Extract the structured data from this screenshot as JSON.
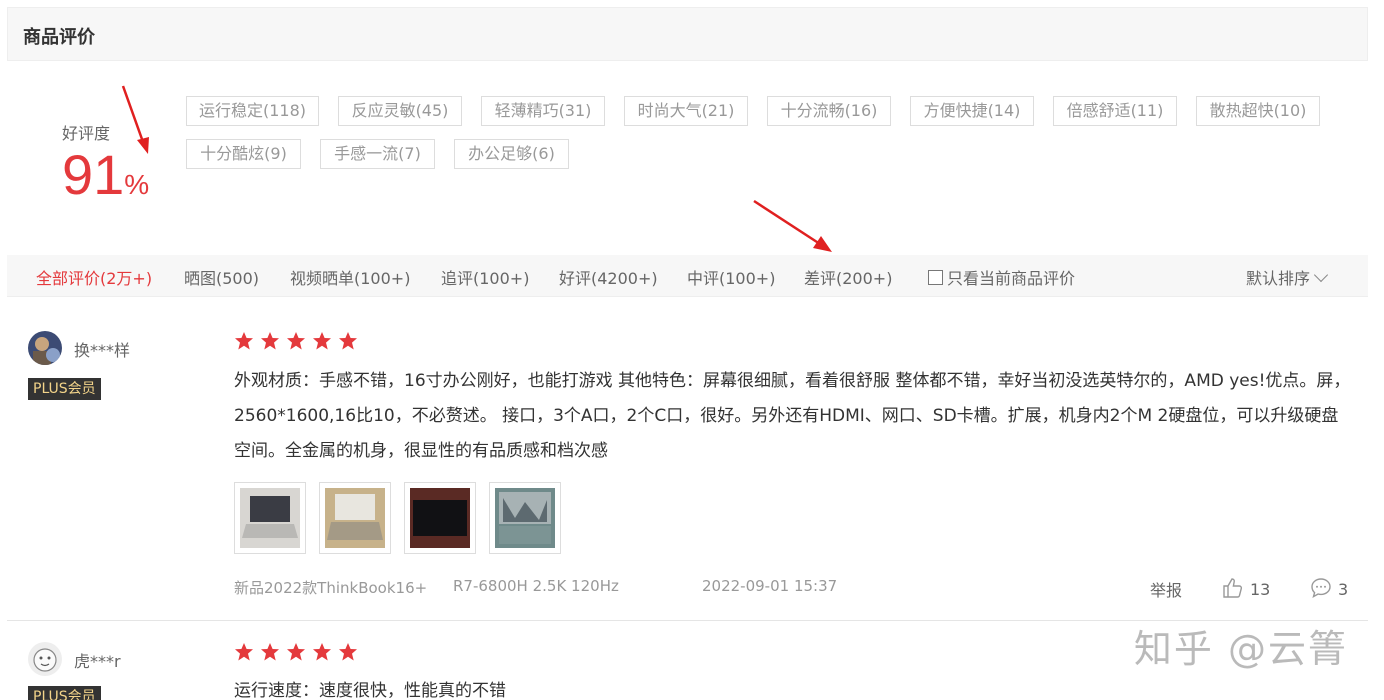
{
  "header": {
    "title": "商品评价"
  },
  "score": {
    "label": "好评度",
    "value": "91",
    "unit": "%"
  },
  "tags": [
    "运行稳定(118)",
    "反应灵敏(45)",
    "轻薄精巧(31)",
    "时尚大气(21)",
    "十分流畅(16)",
    "方便快捷(14)",
    "倍感舒适(11)",
    "散热超快(10)",
    "十分酷炫(9)",
    "手感一流(7)",
    "办公足够(6)"
  ],
  "filters": {
    "tabs": [
      "全部评价(2万+)",
      "晒图(500)",
      "视频晒单(100+)",
      "追评(100+)",
      "好评(4200+)",
      "中评(100+)",
      "差评(200+)"
    ],
    "only_current_label": "只看当前商品评价",
    "sort_label": "默认排序"
  },
  "colors": {
    "accent": "#e4393c",
    "plus_badge_bg": "#333333",
    "plus_badge_text": "#f3d48a"
  },
  "reviews": [
    {
      "username": "换***样",
      "badge": "PLUS会员",
      "rating": 5,
      "text": "外观材质：手感不错，16寸办公刚好，也能打游戏 其他特色：屏幕很细腻，看着很舒服 整体都不错，幸好当初没选英特尔的，AMD yes!优点。屏，2560*1600,16比10，不必赘述。 接口，3个A口，2个C口，很好。另外还有HDMI、网口、SD卡槽。扩展，机身内2个M 2硬盘位，可以升级硬盘空间。全金属的机身，很显性的有品质感和档次感",
      "images": [
        "laptop-photo-1",
        "laptop-photo-2",
        "laptop-photo-3",
        "laptop-photo-4"
      ],
      "product": "新品2022款ThinkBook16+",
      "spec": "R7-6800H 2.5K 120Hz",
      "date": "2022-09-01 15:37",
      "report_label": "举报",
      "likes": "13",
      "comments": "3"
    },
    {
      "username": "虎***r",
      "badge": "PLUS会员",
      "rating": 5,
      "text": "运行速度：速度很快，性能真的不错"
    }
  ],
  "watermark": "知乎 @云箐",
  "icons": {
    "star": "star-icon",
    "like": "thumbs-up-icon",
    "comment": "comment-bubble-icon",
    "arrow": "red-arrow-icon"
  }
}
